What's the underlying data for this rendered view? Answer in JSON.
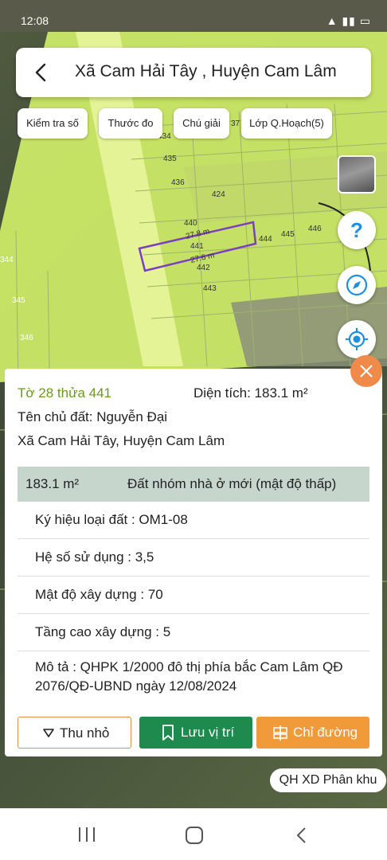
{
  "status_bar": {
    "time": "12:08",
    "indicators": "wifi signal battery"
  },
  "search": {
    "title": "Xã Cam Hải Tây , Huyện Cam Lâm"
  },
  "toolbar": {
    "check_measure": "Kiểm tra số",
    "ruler": "Thước đo",
    "legend": "Chú giải",
    "layer": "Lớp Q.Hoạch(5)"
  },
  "map": {
    "parcel_labels": [
      "434",
      "435",
      "436",
      "424",
      "440",
      "441",
      "442",
      "443",
      "444",
      "445",
      "446",
      "344",
      "345",
      "346",
      "37"
    ],
    "dim_top": "27.8 m",
    "dim_bottom": "27.6 m",
    "highlight_color": "#7b3fbf",
    "zone_color": "#d4f26a"
  },
  "panel": {
    "sheet_parcel": "Tờ 28 thửa 441",
    "area_label": "Diện tích: 183.1 m²",
    "owner": "Tên chủ đất: Nguyễn Đại",
    "address": "Xã Cam Hải Tây, Huyện Cam Lâm",
    "table_area": "183.1 m²",
    "table_type": "Đất nhóm nhà ở mới (mật độ thấp)",
    "land_code": "Ký hiệu loại đất : OM1-08",
    "usage_ratio": "Hệ số sử dụng : 3,5",
    "density": "Mật độ xây dựng : 70",
    "floors": "Tầng cao xây dựng : 5",
    "description": "Mô tả : QHPK 1/2000 đô thị phía bắc Cam Lâm QĐ 2076/QĐ-UBND ngày 12/08/2024"
  },
  "buttons": {
    "collapse": "Thu nhỏ",
    "save": "Lưu vị trí",
    "directions": "Chỉ đường"
  },
  "map_footer": {
    "qh_label": "QH XD Phân khu"
  },
  "colors": {
    "accent_orange": "#f09a3a",
    "save_green": "#1f8a4d",
    "sheet_green": "#6a9a1c"
  }
}
